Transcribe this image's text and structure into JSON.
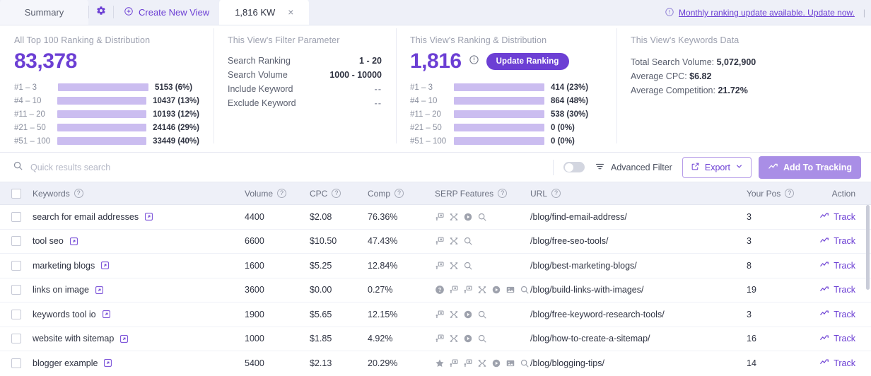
{
  "tabs": {
    "summary_label": "Summary",
    "gear_icon": "gear-icon",
    "create_label": "Create New View",
    "create_icon": "plus-circle-icon",
    "active_label": "1,816 KW",
    "close_glyph": "×"
  },
  "notice": {
    "icon": "info-circle-icon",
    "text": "Monthly ranking update available. Update now.",
    "divider": "|"
  },
  "panels": {
    "all_ranking": {
      "title": "All Top 100 Ranking & Distribution",
      "total": "83,378"
    },
    "filter": {
      "title": "This View's Filter Parameter",
      "rows": [
        {
          "key": "Search Ranking",
          "value": "1 - 20",
          "muted": false
        },
        {
          "key": "Search Volume",
          "value": "1000 - 10000",
          "muted": false
        },
        {
          "key": "Include Keyword",
          "value": "--",
          "muted": true
        },
        {
          "key": "Exclude Keyword",
          "value": "--",
          "muted": true
        }
      ]
    },
    "view_ranking": {
      "title": "This View's Ranking & Distribution",
      "total": "1,816",
      "info_icon": "info-circle-icon",
      "update_button": "Update Ranking"
    },
    "keywords_data": {
      "title": "This View's Keywords Data",
      "lines": [
        {
          "label": "Total Search Volume: ",
          "value": "5,072,900"
        },
        {
          "label": "Average CPC: ",
          "value": "$6.82"
        },
        {
          "label": "Average Competition: ",
          "value": "21.72%"
        }
      ]
    }
  },
  "chart_data": [
    {
      "type": "bar",
      "title": "All Top 100 Ranking & Distribution",
      "total": 83378,
      "categories": [
        "#1 – 3",
        "#4 – 10",
        "#11 – 20",
        "#21 – 50",
        "#51 – 100"
      ],
      "values": [
        5153,
        10437,
        10193,
        24146,
        33449
      ],
      "percents": [
        6,
        13,
        12,
        29,
        40
      ],
      "labels": [
        "5153 (6%)",
        "10437 (13%)",
        "10193 (12%)",
        "24146 (29%)",
        "33449 (40%)"
      ],
      "orientation": "horizontal",
      "xlabel": "",
      "ylabel": "",
      "grid": false,
      "legend": "none",
      "colors": {
        "fill": "#6c2fd6",
        "track": "#cbbdf0"
      }
    },
    {
      "type": "bar",
      "title": "This View's Ranking & Distribution",
      "total": 1816,
      "categories": [
        "#1 – 3",
        "#4 – 10",
        "#11 – 20",
        "#21 – 50",
        "#51 – 100"
      ],
      "values": [
        414,
        864,
        538,
        0,
        0
      ],
      "percents": [
        23,
        48,
        30,
        0,
        0
      ],
      "labels": [
        "414 (23%)",
        "864 (48%)",
        "538 (30%)",
        "0 (0%)",
        "0 (0%)"
      ],
      "orientation": "horizontal",
      "xlabel": "",
      "ylabel": "",
      "grid": false,
      "legend": "none",
      "colors": {
        "fill": "#6c2fd6",
        "track": "#cbbdf0"
      }
    }
  ],
  "toolbar": {
    "search_placeholder": "Quick results search",
    "search_value": "",
    "search_icon": "search-icon",
    "toggle_on": false,
    "filter_icon": "filter-icon",
    "advanced_filter_label": "Advanced Filter",
    "export_label": "Export",
    "export_icon": "external-link-icon",
    "export_caret": "chevron-down-icon",
    "add_tracking_label": "Add To Tracking",
    "add_tracking_icon": "trend-up-icon"
  },
  "table": {
    "columns": [
      {
        "label": "Keywords",
        "help": true
      },
      {
        "label": "Volume",
        "help": true
      },
      {
        "label": "CPC",
        "help": true
      },
      {
        "label": "Comp",
        "help": true
      },
      {
        "label": "SERP Features",
        "help": true
      },
      {
        "label": "URL",
        "help": true
      },
      {
        "label": "Your Pos",
        "help": true
      },
      {
        "label": "Action",
        "help": false
      }
    ],
    "track_label": "Track",
    "rows": [
      {
        "keyword": "search for email addresses",
        "volume": "4400",
        "cpc": "$2.08",
        "comp": "76.36%",
        "serp": [
          "ads-flag-icon",
          "shuffle-icon",
          "video-play-icon",
          "search-icon"
        ],
        "url": "/blog/find-email-address/",
        "pos": "3"
      },
      {
        "keyword": "tool seo",
        "volume": "6600",
        "cpc": "$10.50",
        "comp": "47.43%",
        "serp": [
          "ads-flag-icon",
          "shuffle-icon",
          "search-icon"
        ],
        "url": "/blog/free-seo-tools/",
        "pos": "3"
      },
      {
        "keyword": "marketing blogs",
        "volume": "1600",
        "cpc": "$5.25",
        "comp": "12.84%",
        "serp": [
          "ads-flag-icon",
          "shuffle-icon",
          "search-icon"
        ],
        "url": "/blog/best-marketing-blogs/",
        "pos": "8"
      },
      {
        "keyword": "links on image",
        "volume": "3600",
        "cpc": "$0.00",
        "comp": "0.27%",
        "serp": [
          "question-circle-icon",
          "ads-flag-icon",
          "ads-flag-icon",
          "shuffle-icon",
          "video-play-icon",
          "image-icon",
          "search-icon"
        ],
        "url": "/blog/build-links-with-images/",
        "pos": "19"
      },
      {
        "keyword": "keywords tool io",
        "volume": "1900",
        "cpc": "$5.65",
        "comp": "12.15%",
        "serp": [
          "ads-flag-icon",
          "shuffle-icon",
          "video-play-icon",
          "search-icon"
        ],
        "url": "/blog/free-keyword-research-tools/",
        "pos": "3"
      },
      {
        "keyword": "website with sitemap",
        "volume": "1000",
        "cpc": "$1.85",
        "comp": "4.92%",
        "serp": [
          "ads-flag-icon",
          "shuffle-icon",
          "video-play-icon",
          "search-icon"
        ],
        "url": "/blog/how-to-create-a-sitemap/",
        "pos": "16"
      },
      {
        "keyword": "blogger example",
        "volume": "5400",
        "cpc": "$2.13",
        "comp": "20.29%",
        "serp": [
          "star-icon",
          "ads-flag-icon",
          "ads-flag-icon",
          "shuffle-icon",
          "video-play-icon",
          "image-icon",
          "search-icon"
        ],
        "url": "/blog/blogging-tips/",
        "pos": "14"
      }
    ]
  },
  "colors": {
    "accent": "#6c3fd4",
    "bar_fill": "#6c2fd6",
    "bar_track": "#cbbdf0",
    "header_bg": "#eef0f8"
  }
}
